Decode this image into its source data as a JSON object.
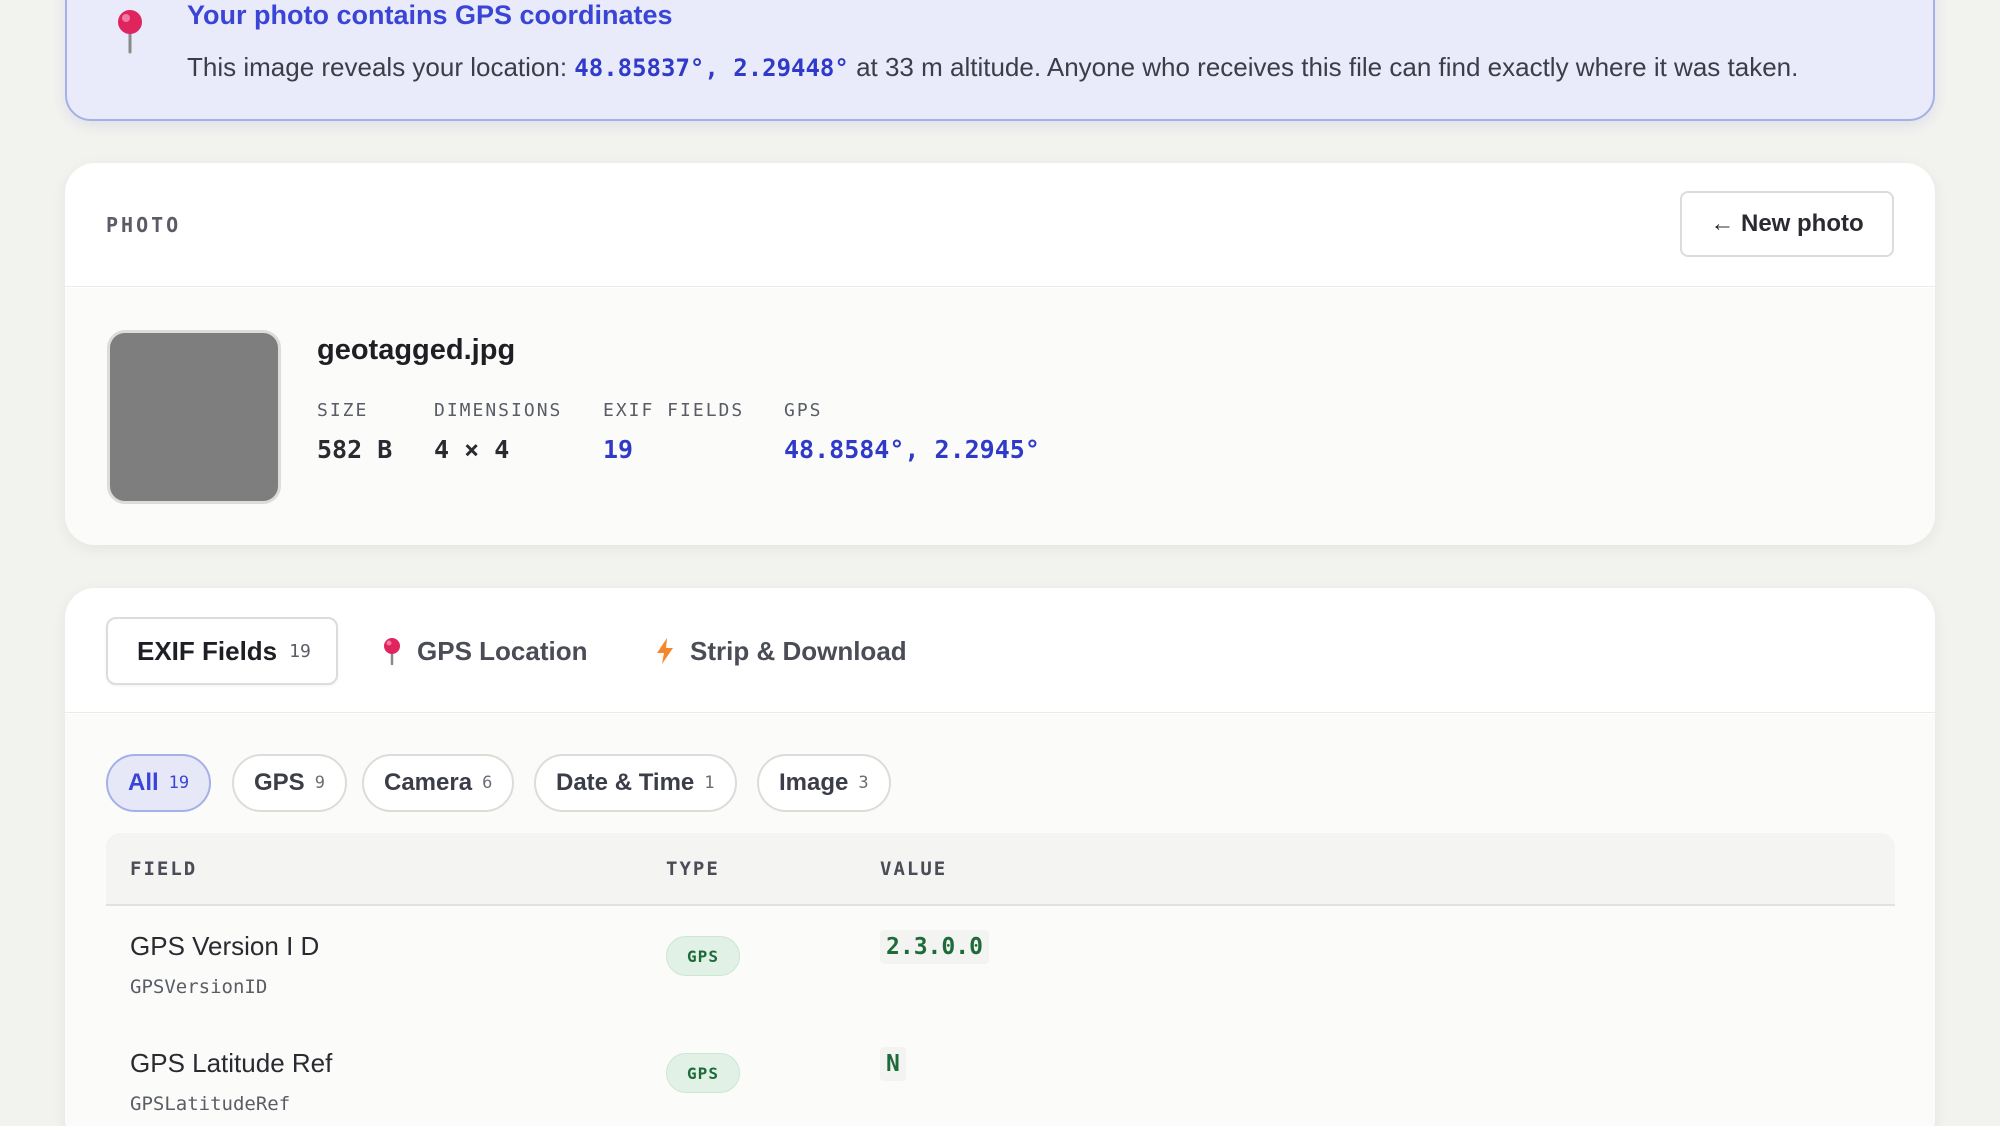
{
  "alert": {
    "title": "Your photo contains GPS coordinates",
    "text_before": "This image reveals your location: ",
    "coords": "48.85837°, 2.29448°",
    "text_after": " at 33 m altitude. Anyone who receives this file can find exactly where it was taken.",
    "icon": "pin-icon"
  },
  "photo_card": {
    "section_label": "PHOTO",
    "new_photo_button": "← New photo",
    "file_name": "geotagged.jpg",
    "meta": [
      {
        "key": "SIZE",
        "value": "582 B"
      },
      {
        "key": "DIMENSIONS",
        "value": "4 × 4"
      },
      {
        "key": "EXIF FIELDS",
        "value": "19"
      },
      {
        "key": "GPS",
        "value": "48.8584°, 2.2945°"
      }
    ]
  },
  "tabs": [
    {
      "label": "EXIF Fields",
      "count": "19"
    },
    {
      "label": "GPS Location",
      "icon": "pin-icon"
    },
    {
      "label": "Strip & Download",
      "icon": "lightning-icon"
    }
  ],
  "filters": [
    {
      "label": "All",
      "count": "19"
    },
    {
      "label": "GPS",
      "count": "9"
    },
    {
      "label": "Camera",
      "count": "6"
    },
    {
      "label": "Date & Time",
      "count": "1"
    },
    {
      "label": "Image",
      "count": "3"
    }
  ],
  "table": {
    "headers": [
      "FIELD",
      "TYPE",
      "VALUE"
    ],
    "rows": [
      {
        "label": "GPS Version I D",
        "key": "GPSVersionID",
        "type": "GPS",
        "value": "2.3.0.0"
      },
      {
        "label": "GPS Latitude Ref",
        "key": "GPSLatitudeRef",
        "type": "GPS",
        "value": "N"
      }
    ]
  },
  "colors": {
    "accent": "#3a45d6",
    "alert_bg": "#e9ebfa",
    "gps_badge": "#e1f1e6",
    "value_green": "#1e6b3a",
    "pin_red": "#e0245e",
    "lightning_orange": "#f5872a"
  }
}
